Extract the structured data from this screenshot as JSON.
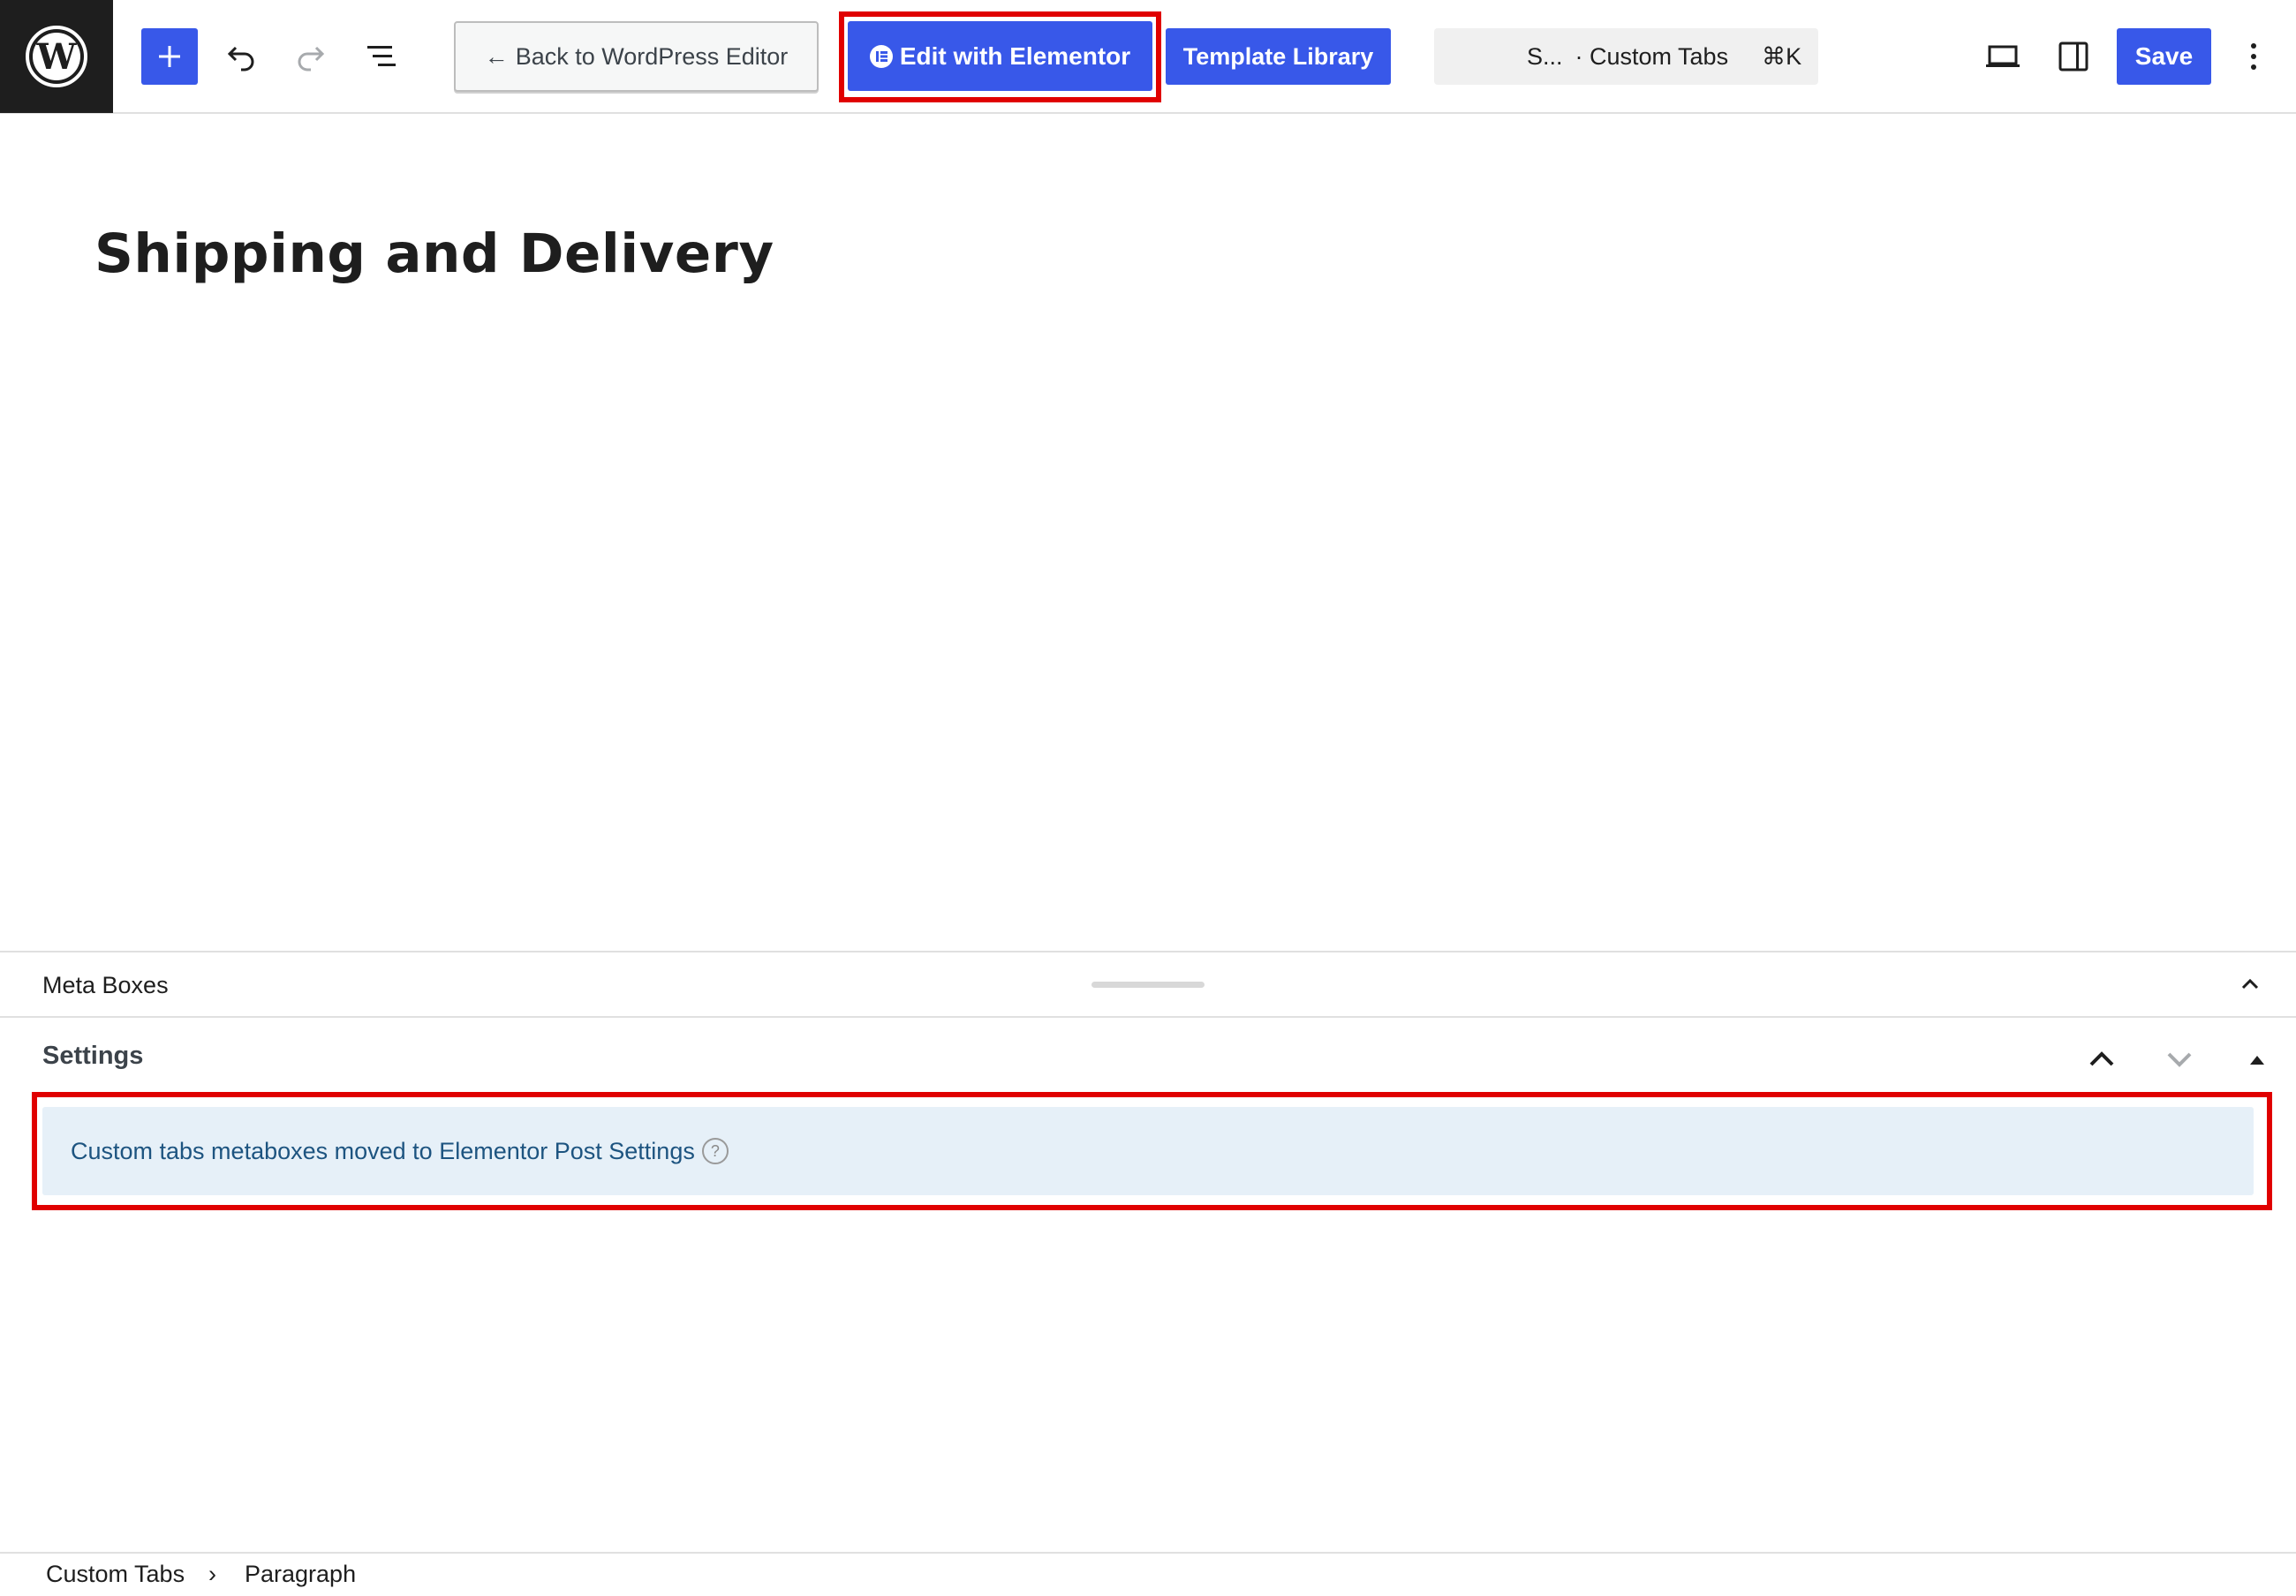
{
  "toolbar": {
    "wp_logo_icon": "wordpress-logo-icon",
    "inserter_icon": "plus-icon",
    "undo_icon": "undo-icon",
    "redo_icon": "redo-icon",
    "list_view_icon": "list-view-icon",
    "back_label": "Back to WordPress Editor",
    "back_arrow": "←",
    "elementor_label": "Edit with Elementor",
    "template_library_label": "Template Library",
    "command_bar": {
      "title": "S...",
      "type": "· Custom Tabs",
      "shortcut": "⌘K"
    },
    "view_icon": "laptop-icon",
    "sidebar_toggle_icon": "sidebar-toggle-icon",
    "save_label": "Save",
    "options_icon": "more-vertical-icon",
    "accent_color": "#3858e9"
  },
  "canvas": {
    "post_title": "Shipping and Delivery"
  },
  "meta_boxes": {
    "header_label": "Meta Boxes",
    "settings": {
      "title": "Settings",
      "notice_text": "Custom tabs metaboxes moved to Elementor Post Settings",
      "help_glyph": "?"
    }
  },
  "footer": {
    "breadcrumb_1": "Custom Tabs",
    "separator": "›",
    "breadcrumb_2": "Paragraph"
  },
  "highlight_color": "#e00000"
}
